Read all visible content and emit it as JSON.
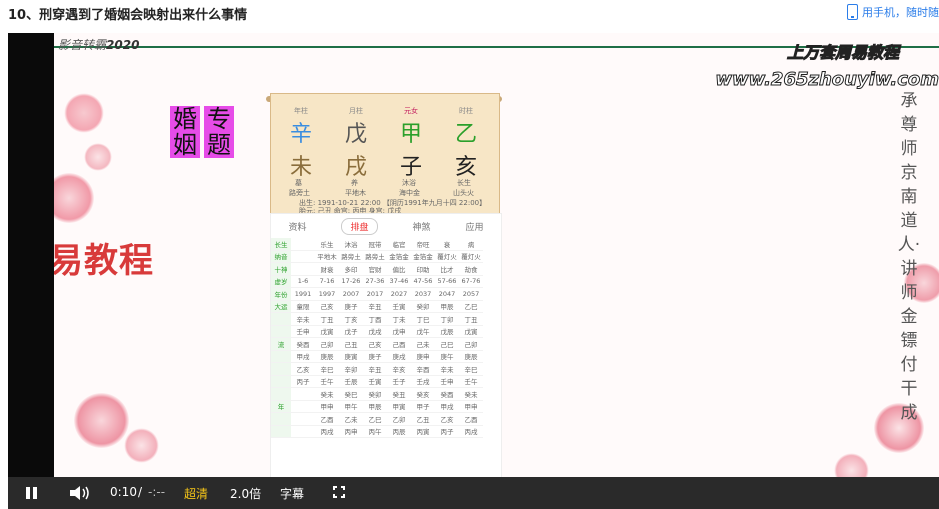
{
  "page": {
    "title": "10、刑穿遇到了婚姻会映射出来什么事情",
    "phone_link": "用手机，随时随"
  },
  "video": {
    "watermark_left_prefix": "影音转霸",
    "watermark_left_year": "2020",
    "site_title": "上万套周易教程",
    "site_url": "www.265zhouyiw.com",
    "vertical_text": "承尊师京南道人·讲师金镖付干成",
    "tag_left": [
      "婚",
      "姻"
    ],
    "tag_right": [
      "专",
      "题"
    ],
    "banner": "九易教程",
    "chart": {
      "pillar_labels": [
        "年柱",
        "月柱",
        "元女",
        "时柱"
      ],
      "stems": [
        "辛",
        "戊",
        "甲",
        "乙"
      ],
      "stem_colors": [
        "#3a8de0",
        "#555",
        "#2ba02b",
        "#2ba02b"
      ],
      "branches": [
        "未",
        "戌",
        "子",
        "亥"
      ],
      "row_labels": [
        "长生",
        "纳音"
      ],
      "changsheng": [
        "墓",
        "养",
        "沐浴",
        "长生"
      ],
      "nayin": [
        "路旁土",
        "平地木",
        "海中金",
        "山头火"
      ],
      "birth_line": "出生: 1991-10-21 22:00 【阴历1991年九月十四 22:00】",
      "info_line": "胎元: 己丑 命宫: 丙申 身宫: 戊戌",
      "tabs": [
        "资料",
        "排盘",
        "神煞",
        "应用"
      ],
      "active_tab": "排盘",
      "table_rows": [
        [
          "长生",
          "",
          "乐生",
          "沐浴",
          "冠带",
          "临官",
          "帝旺",
          "衰",
          "病"
        ],
        [
          "纳音",
          "",
          "平地木",
          "路旁土",
          "路旁土",
          "金箔金",
          "金箔金",
          "覆灯火",
          "覆灯火"
        ],
        [
          "十神",
          "",
          "财衰",
          "多印",
          "官财",
          "偏比",
          "印助",
          "比才",
          "劫食"
        ],
        [
          "虚岁",
          "1-6",
          "7-16",
          "17-26",
          "27-36",
          "37-46",
          "47-56",
          "57-66",
          "67-76"
        ],
        [
          "年份",
          "1991",
          "1997",
          "2007",
          "2017",
          "2027",
          "2037",
          "2047",
          "2057"
        ],
        [
          "大运",
          "童限",
          "己亥",
          "庚子",
          "辛丑",
          "壬寅",
          "癸卯",
          "甲辰",
          "乙巳"
        ],
        [
          "",
          "辛未",
          "丁丑",
          "丁亥",
          "丁酉",
          "丁未",
          "丁巳",
          "丁卯",
          "丁丑"
        ],
        [
          "",
          "壬申",
          "戊寅",
          "戊子",
          "戊戌",
          "戊申",
          "戊午",
          "戊辰",
          "戊寅"
        ],
        [
          "流",
          "癸酉",
          "己卯",
          "己丑",
          "己亥",
          "己酉",
          "己未",
          "己巳",
          "己卯"
        ],
        [
          "",
          "甲戌",
          "庚辰",
          "庚寅",
          "庚子",
          "庚戌",
          "庚申",
          "庚午",
          "庚辰"
        ],
        [
          "",
          "乙亥",
          "辛巳",
          "辛卯",
          "辛丑",
          "辛亥",
          "辛酉",
          "辛未",
          "辛巳"
        ],
        [
          "",
          "丙子",
          "壬午",
          "壬辰",
          "壬寅",
          "壬子",
          "壬戌",
          "壬申",
          "壬午"
        ],
        [
          "",
          "",
          "癸未",
          "癸巳",
          "癸卯",
          "癸丑",
          "癸亥",
          "癸酉",
          "癸未"
        ],
        [
          "年",
          "",
          "甲申",
          "甲午",
          "甲辰",
          "甲寅",
          "甲子",
          "甲戌",
          "甲申"
        ],
        [
          "",
          "",
          "乙酉",
          "乙未",
          "乙巳",
          "乙卯",
          "乙丑",
          "乙亥",
          "乙酉"
        ],
        [
          "",
          "",
          "丙戌",
          "丙申",
          "丙午",
          "丙辰",
          "丙寅",
          "丙子",
          "丙戌"
        ]
      ]
    }
  },
  "controls": {
    "time_current": "0:10",
    "time_sep": "/",
    "time_total": "-:--",
    "quality": "超清",
    "speed": "2.0倍",
    "subtitle": "字幕",
    "quality_color": "#f5c518"
  }
}
